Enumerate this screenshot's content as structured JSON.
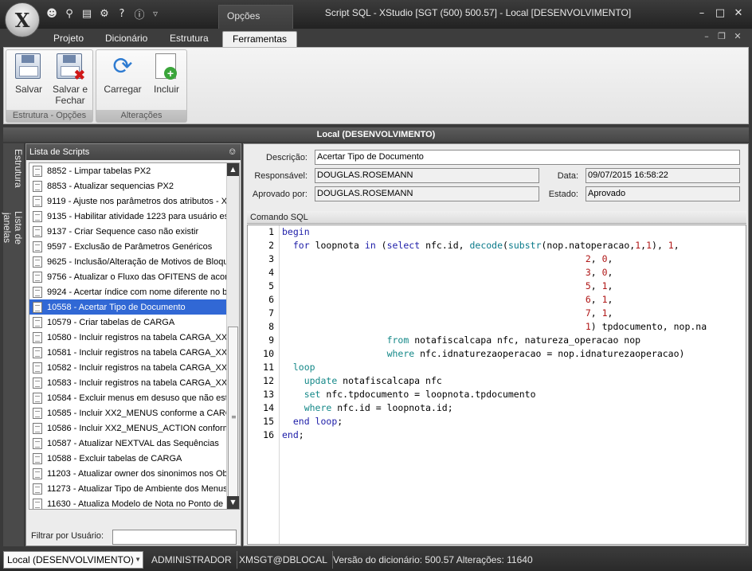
{
  "window": {
    "title": "Script SQL - XStudio [SGT (500) 500.57] - Local [DESENVOLVIMENTO]",
    "context_tab": "Opções",
    "orb_label": "X"
  },
  "quick_access": [
    "users-icon",
    "search-icon",
    "document-icon",
    "gear-icon",
    "help-icon",
    "info-icon"
  ],
  "ribbon_tabs": [
    {
      "label": "Projeto"
    },
    {
      "label": "Dicionário"
    },
    {
      "label": "Estrutura"
    },
    {
      "label": "Ferramentas",
      "active": true
    }
  ],
  "ribbon_groups": [
    {
      "caption": "Estrutura - Opções",
      "buttons": [
        {
          "label": "Salvar",
          "icon": "save-icon"
        },
        {
          "label": "Salvar e Fechar",
          "icon": "save-close-icon"
        }
      ]
    },
    {
      "caption": "Alterações",
      "buttons": [
        {
          "label": "Carregar",
          "icon": "reload-icon"
        },
        {
          "label": "Incluir",
          "icon": "add-document-icon"
        }
      ]
    }
  ],
  "header": {
    "title": "Local (DESENVOLVIMENTO)"
  },
  "side_tabs": [
    "Estrutura",
    "Lista de janelas"
  ],
  "scripts_panel": {
    "title": "Lista de Scripts",
    "items": [
      {
        "label": "8852 - Limpar tabelas PX2"
      },
      {
        "label": "8853 - Atualizar sequencias PX2"
      },
      {
        "label": "9119 - Ajuste nos parâmetros dos atributos - X"
      },
      {
        "label": "9135 - Habilitar atividade 1223 para usuário esp"
      },
      {
        "label": "9137 - Criar Sequence caso não existir"
      },
      {
        "label": "9597 - Exclusão de Parâmetros Genéricos"
      },
      {
        "label": "9625 - Inclusão/Alteração de Motivos de Bloque"
      },
      {
        "label": "9756 - Atualizar o Fluxo das OFITENS de acord"
      },
      {
        "label": "9924 - Acertar índice com nome diferente no ba"
      },
      {
        "label": "10558 - Acertar Tipo de Documento",
        "selected": true
      },
      {
        "label": "10579 - Criar tabelas de CARGA"
      },
      {
        "label": "10580 - Incluir registros na tabela CARGA_XX2_"
      },
      {
        "label": "10581 - Incluir registros na tabela CARGA_XX2_"
      },
      {
        "label": "10582 - Incluir registros na tabela CARGA_XX2_"
      },
      {
        "label": "10583 - Incluir registros na tabela CARGA_XX2_"
      },
      {
        "label": "10584 - Excluir menus em desuso que não está"
      },
      {
        "label": "10585 - Incluir XX2_MENUS conforme a CARGA"
      },
      {
        "label": "10586 - Incluir XX2_MENUS_ACTION conforme"
      },
      {
        "label": "10587 - Atualizar NEXTVAL das Sequências"
      },
      {
        "label": "10588 - Excluir tabelas de CARGA"
      },
      {
        "label": "11203 - Atualizar owner dos sinonimos nos Obj"
      },
      {
        "label": "11273 - Atualizar Tipo de Ambiente dos Menus"
      },
      {
        "label": "11630 - Atualiza Modelo de Nota no Ponto de F"
      }
    ],
    "filter_label": "Filtrar por Usuário:",
    "filter_value": ""
  },
  "details": {
    "descricao_label": "Descrição:",
    "descricao": "Acertar Tipo de Documento",
    "responsavel_label": "Responsável:",
    "responsavel": "DOUGLAS.ROSEMANN",
    "data_label": "Data:",
    "data": "09/07/2015 16:58:22",
    "aprovado_label": "Aprovado por:",
    "aprovado": "DOUGLAS.ROSEMANN",
    "estado_label": "Estado:",
    "estado": "Aprovado"
  },
  "editor": {
    "title": "Comando SQL",
    "lines": [
      [
        [
          "kw",
          "begin"
        ]
      ],
      [
        [
          "",
          "  "
        ],
        [
          "kw",
          "for"
        ],
        [
          "",
          " loopnota "
        ],
        [
          "kw",
          "in"
        ],
        [
          "",
          " ("
        ],
        [
          "kw",
          "select"
        ],
        [
          "",
          " nfc.id, "
        ],
        [
          "fn",
          "decode"
        ],
        [
          "",
          "("
        ],
        [
          "fn",
          "substr"
        ],
        [
          "",
          "(nop.natoperacao,"
        ],
        [
          "num",
          "1"
        ],
        [
          "",
          ","
        ],
        [
          "num",
          "1"
        ],
        [
          "",
          "), "
        ],
        [
          "num",
          "1"
        ],
        [
          "",
          ", "
        ]
      ],
      [
        [
          "",
          "                                                       "
        ],
        [
          "num",
          "2"
        ],
        [
          "",
          ", "
        ],
        [
          "num",
          "0"
        ],
        [
          "",
          ","
        ]
      ],
      [
        [
          "",
          "                                                       "
        ],
        [
          "num",
          "3"
        ],
        [
          "",
          ", "
        ],
        [
          "num",
          "0"
        ],
        [
          "",
          ","
        ]
      ],
      [
        [
          "",
          "                                                       "
        ],
        [
          "num",
          "5"
        ],
        [
          "",
          ", "
        ],
        [
          "num",
          "1"
        ],
        [
          "",
          ","
        ]
      ],
      [
        [
          "",
          "                                                       "
        ],
        [
          "num",
          "6"
        ],
        [
          "",
          ", "
        ],
        [
          "num",
          "1"
        ],
        [
          "",
          ","
        ]
      ],
      [
        [
          "",
          "                                                       "
        ],
        [
          "num",
          "7"
        ],
        [
          "",
          ", "
        ],
        [
          "num",
          "1"
        ],
        [
          "",
          ","
        ]
      ],
      [
        [
          "",
          "                                                       "
        ],
        [
          "num",
          "1"
        ],
        [
          "",
          ") tpdocumento, nop.na"
        ]
      ],
      [
        [
          "",
          "                   "
        ],
        [
          "kw2",
          "from"
        ],
        [
          "",
          " notafiscalcapa nfc, natureza_operacao nop"
        ]
      ],
      [
        [
          "",
          "                   "
        ],
        [
          "kw2",
          "where"
        ],
        [
          "",
          " nfc.idnaturezaoperacao = nop.idnaturezaoperacao)"
        ]
      ],
      [
        [
          "",
          "  "
        ],
        [
          "kw2",
          "loop"
        ]
      ],
      [
        [
          "",
          "    "
        ],
        [
          "kw2",
          "update"
        ],
        [
          "",
          " notafiscalcapa nfc"
        ]
      ],
      [
        [
          "",
          "    "
        ],
        [
          "kw2",
          "set"
        ],
        [
          "",
          " nfc.tpdocumento = loopnota.tpdocumento"
        ]
      ],
      [
        [
          "",
          "    "
        ],
        [
          "kw2",
          "where"
        ],
        [
          "",
          " nfc.id = loopnota.id;"
        ]
      ],
      [
        [
          "",
          "  "
        ],
        [
          "kw",
          "end loop"
        ],
        [
          "",
          ";"
        ]
      ],
      [
        [
          "kw",
          "end"
        ],
        [
          "",
          ";"
        ]
      ]
    ]
  },
  "statusbar": {
    "connection": "Local (DESENVOLVIMENTO)",
    "user": "ADMINISTRADOR",
    "schema": "XMSGT@DBLOCAL",
    "version": "Versão do dicionário: 500.57 Alterações: 11640"
  }
}
